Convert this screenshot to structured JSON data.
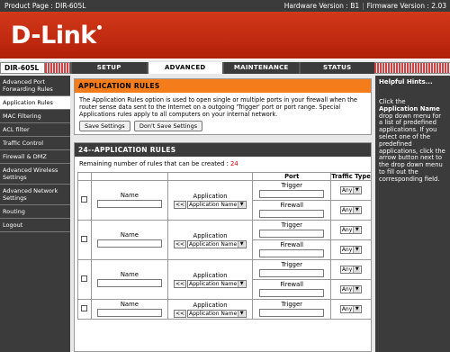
{
  "topbar": {
    "product_label": "Product Page : DIR-605L",
    "hardware_label": "Hardware Version : B1",
    "firmware_label": "Firmware Version : 2.03"
  },
  "brand": {
    "logo_text": "D-Link"
  },
  "model": "DIR-605L",
  "tabs": [
    {
      "label": "SETUP"
    },
    {
      "label": "ADVANCED"
    },
    {
      "label": "MAINTENANCE"
    },
    {
      "label": "STATUS"
    }
  ],
  "sidebar": {
    "items": [
      {
        "label": "Advanced Port Forwarding Rules"
      },
      {
        "label": "Application Rules"
      },
      {
        "label": "MAC Filtering"
      },
      {
        "label": "ACL filter"
      },
      {
        "label": "Traffic Control"
      },
      {
        "label": "Firewall & DMZ"
      },
      {
        "label": "Advanced Wireless Settings"
      },
      {
        "label": "Advanced Network Settings"
      },
      {
        "label": "Routing"
      },
      {
        "label": "Logout"
      }
    ]
  },
  "intro": {
    "title": "APPLICATION RULES",
    "text": "The Application Rules option is used to open single or multiple ports in your firewall when the router sense data sent to the Internet on a outgoing 'Trigger' port or port range. Special Applications rules apply to all computers on your internal network.",
    "save_label": "Save Settings",
    "dont_save_label": "Don't Save Settings"
  },
  "rules": {
    "title": "24--APPLICATION RULES",
    "remaining_label": "Remaining number of rules that can be created :",
    "remaining_count": "24",
    "col_port": "Port",
    "col_traffic": "Traffic Type",
    "name_label": "Name",
    "application_label": "Application",
    "copy_button": "<<",
    "app_select_value": "Application Name",
    "trigger_label": "Trigger",
    "firewall_label": "Firewall",
    "traffic_value": "Any"
  },
  "hints": {
    "title": "Helpful Hints...",
    "intro": "Click the ",
    "bold": "Application Name",
    "rest": " drop down menu for a list of predefined applications. If you select one of the predefined applications, click the arrow button next to the drop down menu to fill out the corresponding field."
  }
}
